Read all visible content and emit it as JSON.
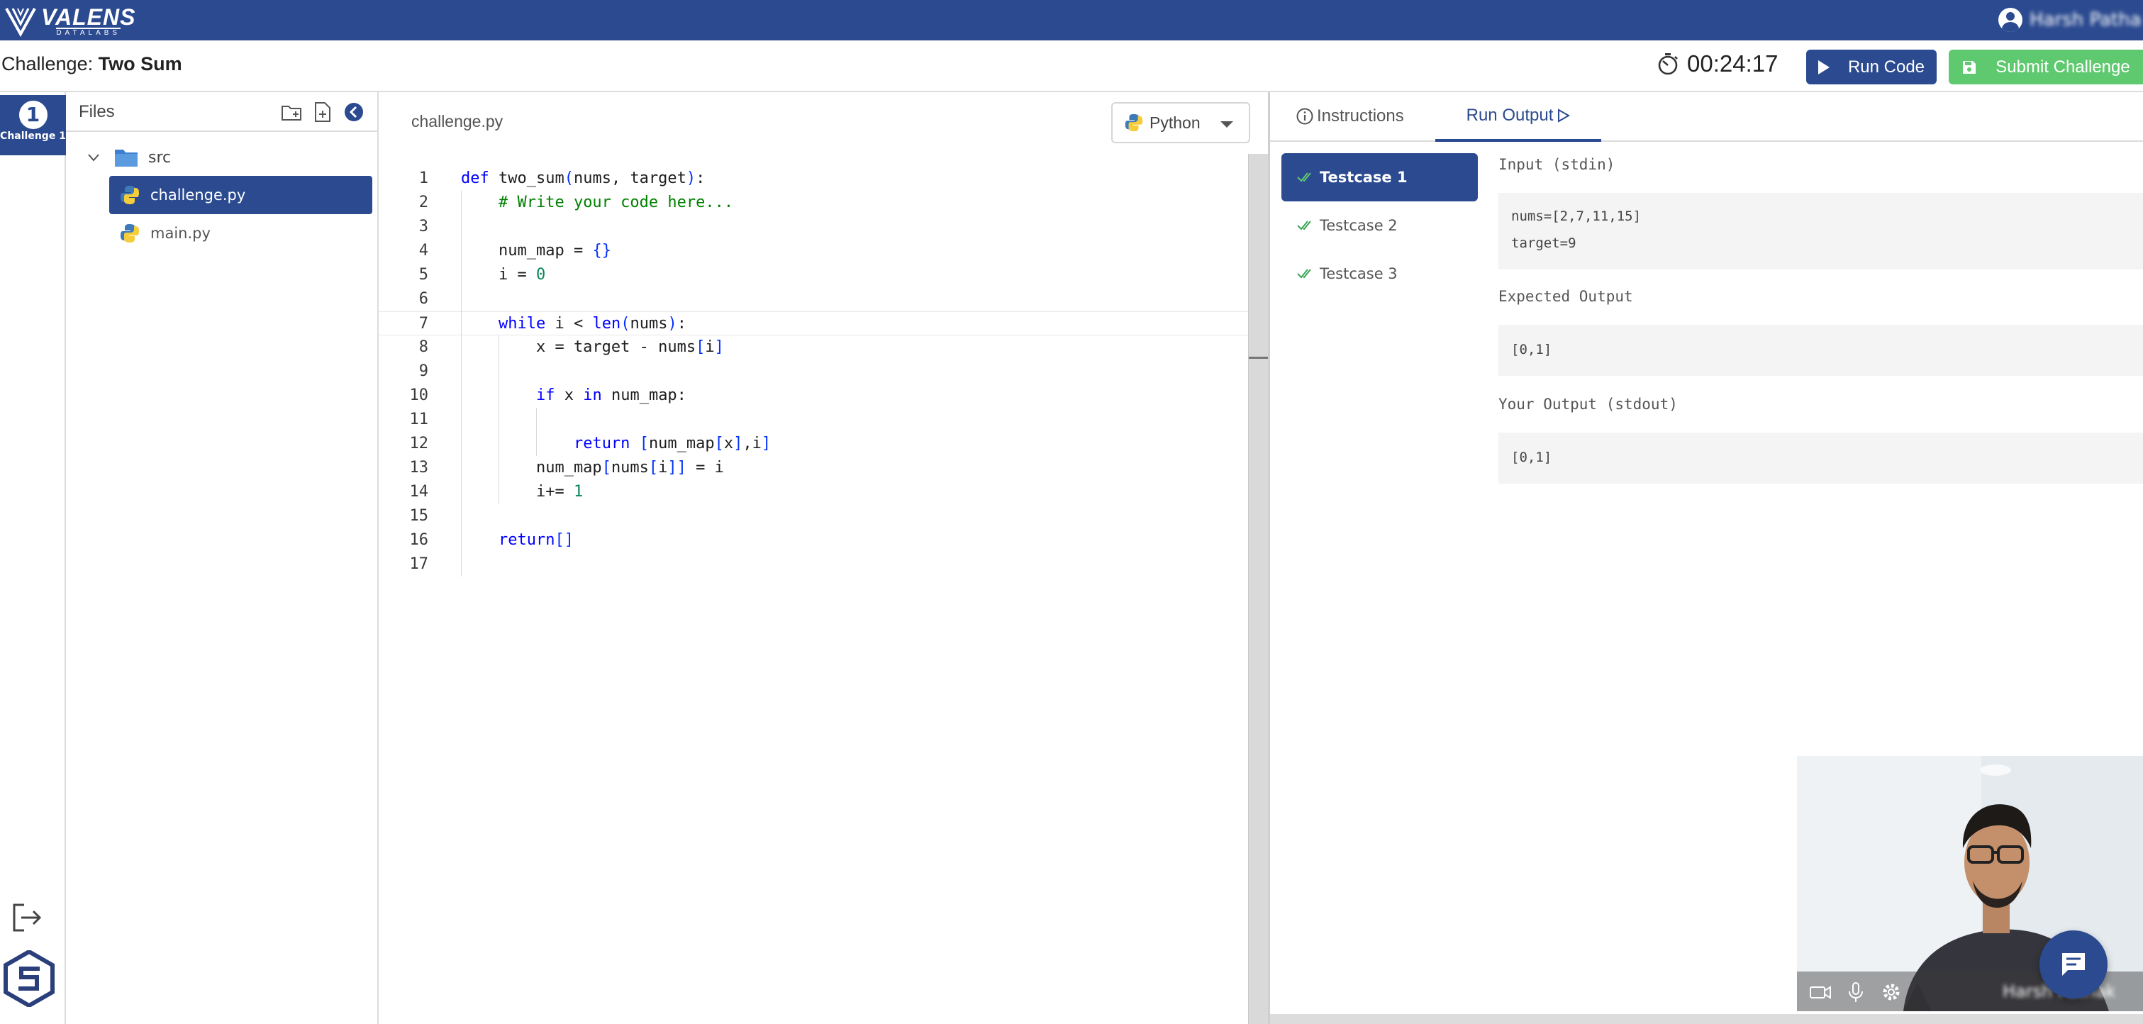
{
  "topbar": {
    "logo_text": "VALENS",
    "logo_subtext": "DATALABS",
    "user_name": "Harsh Pathak"
  },
  "header": {
    "challenge_prefix": "Challenge:",
    "challenge_name": "Two Sum",
    "timer": "00:24:17",
    "run_label": "Run Code",
    "submit_label": "Submit Challenge"
  },
  "rail": {
    "challenge_number": "1",
    "challenge_label": "Challenge 1"
  },
  "files": {
    "title": "Files",
    "folder": "src",
    "items": [
      {
        "name": "challenge.py",
        "active": true
      },
      {
        "name": "main.py",
        "active": false
      }
    ]
  },
  "editor": {
    "tab": "challenge.py",
    "language": "Python",
    "current_line": 7,
    "lines": [
      "def two_sum(nums, target):",
      "    # Write your code here...",
      "",
      "    num_map = {}",
      "    i = 0",
      "",
      "    while i < len(nums):",
      "        x = target - nums[i]",
      "",
      "        if x in num_map:",
      "",
      "            return [num_map[x],i]",
      "        num_map[nums[i]] = i",
      "        i+= 1",
      "",
      "    return[]",
      ""
    ]
  },
  "right": {
    "tab_instructions": "Instructions",
    "tab_run_output": "Run Output",
    "testcases": [
      "Testcase 1",
      "Testcase 2",
      "Testcase 3"
    ],
    "input_label": "Input (stdin)",
    "input_value": "nums=[2,7,11,15]\ntarget=9",
    "expected_label": "Expected Output",
    "expected_value": "[0,1]",
    "your_label": "Your Output (stdout)",
    "your_value": "[0,1]"
  },
  "camera": {
    "name": "Harsh Pathak"
  },
  "colors": {
    "primary": "#2b4a8f",
    "success": "#5fc970",
    "check": "#3aa455"
  }
}
